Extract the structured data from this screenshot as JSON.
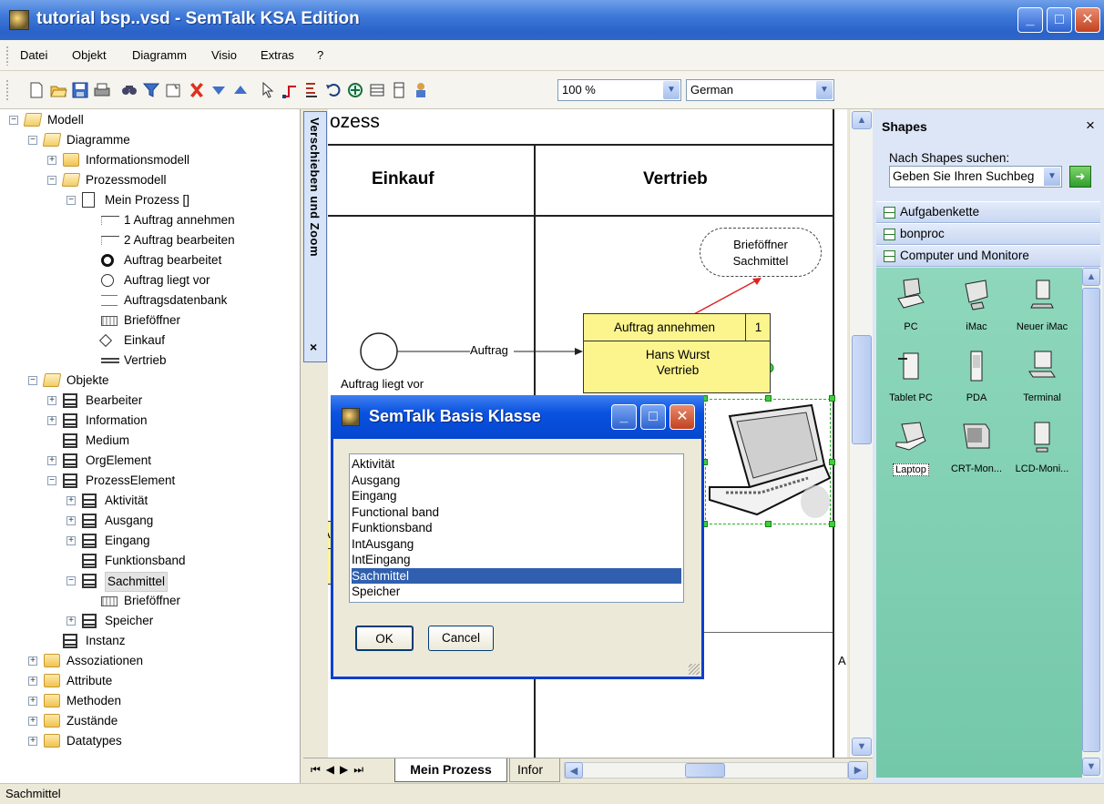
{
  "window": {
    "title": "tutorial bsp..vsd - SemTalk KSA Edition",
    "controls": [
      "minimize",
      "maximize",
      "close"
    ]
  },
  "menubar": {
    "items": [
      "Datei",
      "Objekt",
      "Diagramm",
      "Visio",
      "Extras",
      "?"
    ]
  },
  "toolbar": {
    "icons": [
      "new-icon",
      "open-icon",
      "save-icon",
      "print-icon",
      "find-icon",
      "filter-icon",
      "properties-icon",
      "delete-icon",
      "arrow-down-icon",
      "arrow-up-icon",
      "pointer-icon",
      "connector-icon",
      "text-icon",
      "undo-icon",
      "zoom-icon",
      "panel-icon",
      "page-icon",
      "people-icon"
    ],
    "zoom_value": "100 %",
    "language_value": "German"
  },
  "tree": {
    "nodes": [
      {
        "label": "Modell",
        "icon": "folder-open",
        "level": 0,
        "expander": "-"
      },
      {
        "label": "Diagramme",
        "icon": "folder-open",
        "level": 1,
        "expander": "-"
      },
      {
        "label": "Informationsmodell",
        "icon": "folder",
        "level": 2,
        "expander": "+"
      },
      {
        "label": "Prozessmodell",
        "icon": "folder-open",
        "level": 2,
        "expander": "-"
      },
      {
        "label": "Mein Prozess []",
        "icon": "page",
        "level": 3,
        "expander": "-"
      },
      {
        "label": "1 Auftrag annehmen",
        "icon": "lineshape",
        "level": 4,
        "expander": ""
      },
      {
        "label": "2 Auftrag bearbeiten",
        "icon": "lineshape",
        "level": 4,
        "expander": ""
      },
      {
        "label": "Auftrag bearbeitet",
        "icon": "circ-thick",
        "level": 4,
        "expander": ""
      },
      {
        "label": "Auftrag liegt vor",
        "icon": "circ-thin",
        "level": 4,
        "expander": ""
      },
      {
        "label": "Auftragsdatenbank",
        "icon": "db",
        "level": 4,
        "expander": ""
      },
      {
        "label": "Brieföffner",
        "icon": "keyboard",
        "level": 4,
        "expander": ""
      },
      {
        "label": "Einkauf",
        "icon": "diamond",
        "level": 4,
        "expander": ""
      },
      {
        "label": "Vertrieb",
        "icon": "dbl",
        "level": 4,
        "expander": ""
      },
      {
        "label": "Objekte",
        "icon": "folder-open",
        "level": 1,
        "expander": "-"
      },
      {
        "label": "Bearbeiter",
        "icon": "table",
        "level": 2,
        "expander": "+"
      },
      {
        "label": "Information",
        "icon": "table",
        "level": 2,
        "expander": "+"
      },
      {
        "label": "Medium",
        "icon": "table",
        "level": 2,
        "expander": ""
      },
      {
        "label": "OrgElement",
        "icon": "table",
        "level": 2,
        "expander": "+"
      },
      {
        "label": "ProzessElement",
        "icon": "table",
        "level": 2,
        "expander": "-"
      },
      {
        "label": "Aktivität",
        "icon": "table",
        "level": 3,
        "expander": "+"
      },
      {
        "label": "Ausgang",
        "icon": "table",
        "level": 3,
        "expander": "+"
      },
      {
        "label": "Eingang",
        "icon": "table",
        "level": 3,
        "expander": "+"
      },
      {
        "label": "Funktionsband",
        "icon": "table",
        "level": 3,
        "expander": ""
      },
      {
        "label": "Sachmittel",
        "icon": "table",
        "level": 3,
        "expander": "-",
        "selected": true
      },
      {
        "label": "Brieföffner",
        "icon": "keyboard",
        "level": 4,
        "expander": ""
      },
      {
        "label": "Speicher",
        "icon": "table",
        "level": 3,
        "expander": "+"
      },
      {
        "label": "Instanz",
        "icon": "table",
        "level": 2,
        "expander": ""
      },
      {
        "label": "Assoziationen",
        "icon": "folder",
        "level": 1,
        "expander": "+"
      },
      {
        "label": "Attribute",
        "icon": "folder",
        "level": 1,
        "expander": "+"
      },
      {
        "label": "Methoden",
        "icon": "folder",
        "level": 1,
        "expander": "+"
      },
      {
        "label": "Zustände",
        "icon": "folder",
        "level": 1,
        "expander": "+"
      },
      {
        "label": "Datatypes",
        "icon": "folder",
        "level": 1,
        "expander": "+"
      }
    ]
  },
  "side_tab": {
    "label": "Verschieben und Zoom",
    "close": "×"
  },
  "canvas": {
    "pool_title": "ozess",
    "lane1": "Einkauf",
    "lane2": "Vertrieb",
    "resource_label": "Brieföffner\nSachmittel",
    "task_name": "Auftrag annehmen",
    "task_number": "1",
    "task_detail": "Hans Wurst\nVertrieb",
    "event_label": "Auftrag liegt vor",
    "flow_label": "Auftrag",
    "partial_a1": "A",
    "partial_a2": "A"
  },
  "bottom_tabs": {
    "active": "Mein Prozess",
    "other": "Infor"
  },
  "shapes_panel": {
    "title": "Shapes",
    "close": "×",
    "search_label": "Nach Shapes suchen:",
    "search_placeholder": "Geben Sie Ihren Suchbeg",
    "stencils": [
      "Aufgabenkette",
      "bonproc",
      "Computer und Monitore"
    ],
    "items": [
      "PC",
      "iMac",
      "Neuer iMac",
      "Tablet PC",
      "PDA",
      "Terminal",
      "Laptop",
      "CRT-Mon...",
      "LCD-Moni..."
    ],
    "selected_item": "Laptop"
  },
  "dialog": {
    "title": "SemTalk Basis Klasse",
    "options": [
      "Aktivität",
      "Ausgang",
      "Eingang",
      "Functional band",
      "Funktionsband",
      "IntAusgang",
      "IntEingang",
      "Sachmittel",
      "Speicher"
    ],
    "selected": "Sachmittel",
    "ok_label": "OK",
    "cancel_label": "Cancel"
  },
  "statusbar": {
    "text": "Sachmittel"
  },
  "colors": {
    "titlebar": "#2a62c8",
    "task_fill": "#fcf58e",
    "stencil_area": "#80cfb2",
    "selection": "#2f5fae"
  }
}
